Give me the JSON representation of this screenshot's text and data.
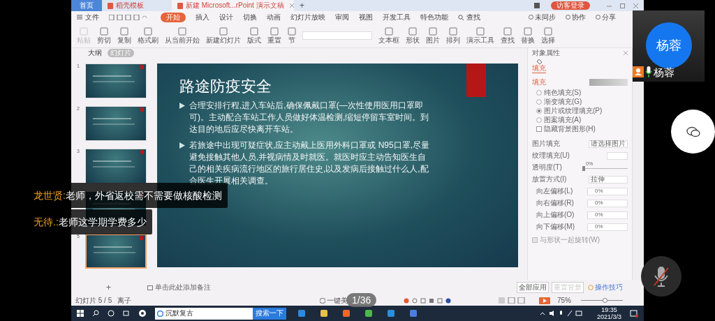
{
  "tabs": [
    {
      "label": "首页",
      "kind": "home",
      "selected": false
    },
    {
      "label": "稻壳模板",
      "kind": "template",
      "selected": false
    },
    {
      "label": "新建 Microsoft...rPoint 演示文稿",
      "kind": "doc",
      "selected": true
    }
  ],
  "new_tab": "+",
  "login_button": "访客登录",
  "menu": {
    "file": "文件",
    "items": [
      {
        "label": "开始",
        "selected": true
      },
      {
        "label": "插入",
        "selected": false
      },
      {
        "label": "设计",
        "selected": false
      },
      {
        "label": "切换",
        "selected": false
      },
      {
        "label": "动画",
        "selected": false
      },
      {
        "label": "幻灯片放映",
        "selected": false
      },
      {
        "label": "审阅",
        "selected": false
      },
      {
        "label": "视图",
        "selected": false
      },
      {
        "label": "开发工具",
        "selected": false
      },
      {
        "label": "特色功能",
        "selected": false
      }
    ],
    "search": "查找",
    "actions": [
      "未同步",
      "协作",
      "分享"
    ]
  },
  "toolbar": [
    {
      "label": "粘贴",
      "disabled": true
    },
    {
      "label": "剪切",
      "disabled": false
    },
    {
      "label": "复制",
      "disabled": false
    },
    {
      "label": "格式刷",
      "disabled": false
    },
    {
      "label": "从当前开始",
      "disabled": false
    },
    {
      "label": "新建幻灯片",
      "disabled": false
    },
    {
      "label": "版式",
      "disabled": false
    },
    {
      "label": "重置",
      "disabled": false
    },
    {
      "label": "节",
      "disabled": false
    },
    {
      "label": "文本框",
      "disabled": false
    },
    {
      "label": "形状",
      "disabled": false
    },
    {
      "label": "图片",
      "disabled": false
    },
    {
      "label": "排列",
      "disabled": false
    },
    {
      "label": "演示工具",
      "disabled": false
    },
    {
      "label": "查找",
      "disabled": false
    },
    {
      "label": "替换",
      "disabled": false
    },
    {
      "label": "选择",
      "disabled": false
    }
  ],
  "panel_tabs": [
    {
      "label": "大纲",
      "selected": false
    },
    {
      "label": "幻灯片",
      "selected": true
    }
  ],
  "thumbnails": [
    {
      "number": "1",
      "selected": false
    },
    {
      "number": "2",
      "selected": false
    },
    {
      "number": "3",
      "selected": false
    },
    {
      "selected": false
    },
    {
      "number": "5",
      "selected": true
    }
  ],
  "slide": {
    "title": "路途防疫安全",
    "bullets": [
      "合理安排行程,进入车站后,确保佩戴口罩(—次性使用医用口罩即可)。主动配合车站工作人员做好体温检测,缩短停留车室时间。到达目的地后应尽快离开车站。",
      "若旅途中出现可疑症状,应主动戴上医用外科口罩或 N95口罩,尽量避免接触其他人员,并视病情及时就医。就医时应主动告知医生自己的相关疾病流行地区的旅行居住史,以及发病后接触过什么人,配合医生开展相关调查。"
    ]
  },
  "properties": {
    "title": "对象属性",
    "tab": "填充",
    "section": "填充",
    "options": [
      {
        "label": "纯色填充(S)",
        "kind": "radio",
        "checked": false
      },
      {
        "label": "渐变填充(G)",
        "kind": "radio",
        "checked": false
      },
      {
        "label": "图片或纹理填充(P)",
        "kind": "radio",
        "checked": true
      },
      {
        "label": "图案填充(A)",
        "kind": "radio",
        "checked": false
      },
      {
        "label": "隐藏背景图形(H)",
        "kind": "checkbox",
        "checked": false
      }
    ],
    "fields": [
      {
        "label": "图片填充",
        "kind": "select",
        "value": "请选择图片"
      },
      {
        "label": "纹理填充(U)",
        "kind": "texture"
      },
      {
        "label": "透明度(T)",
        "kind": "slider",
        "value": "0%",
        "level": 0
      },
      {
        "label": "放置方式(I)",
        "kind": "select",
        "value": "拉伸"
      },
      {
        "label": "向左偏移(L)",
        "kind": "spin",
        "value": "0%"
      },
      {
        "label": "向右偏移(R)",
        "kind": "spin",
        "value": "0%"
      },
      {
        "label": "向上偏移(O)",
        "kind": "spin",
        "value": "0%"
      },
      {
        "label": "向下偏移(M)",
        "kind": "spin",
        "value": "0%"
      }
    ],
    "rotate": {
      "label": "与形状一起旋转(W)",
      "checked": false,
      "disabled": true
    },
    "buttons": [
      {
        "label": "全部应用",
        "disabled": false
      },
      {
        "label": "重置背景",
        "disabled": true
      }
    ],
    "tips": "操作技巧"
  },
  "notes": {
    "add": "+",
    "placeholder": "单击此处添加备注"
  },
  "status_bar": {
    "slide": "幻灯片 5 / 5",
    "theme": "离子",
    "beautify": "一键美",
    "zoom": "75%",
    "zoom_slider": {
      "level": 0.55
    }
  },
  "page_counter": "1/36",
  "taskbar": {
    "search_value": "沉默复古",
    "search_button": "搜索一下",
    "time": "19:35",
    "date": "2021/3/3"
  },
  "chat": [
    {
      "name": "龙世贤:",
      "text": "老师，外省返校需不需要做核酸检测"
    },
    {
      "name": "无待.:",
      "text": "老师这学期学费多少"
    }
  ],
  "video": {
    "avatar": "杨蓉",
    "name": "杨蓉",
    "mic_on": true
  },
  "mic_muted": true
}
